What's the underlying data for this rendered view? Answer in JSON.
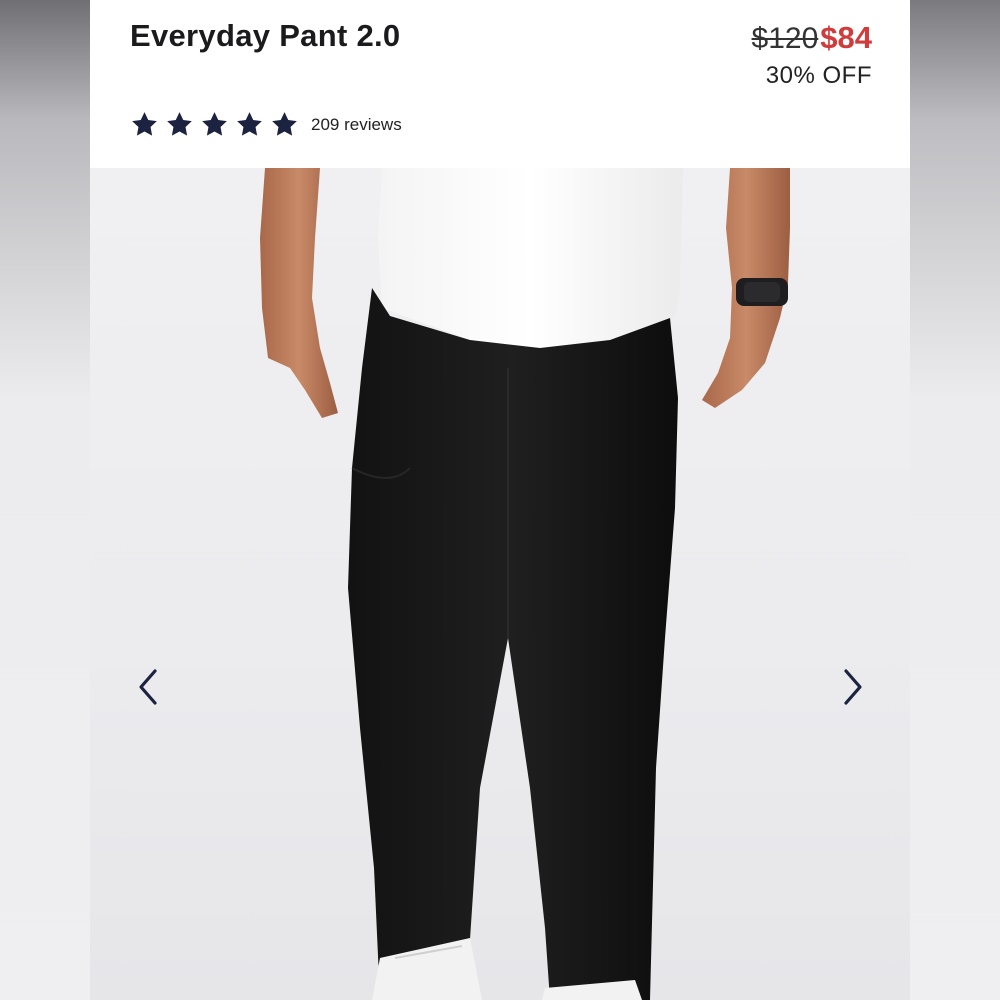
{
  "product": {
    "title": "Everyday Pant 2.0",
    "price_original": "$120",
    "price_sale": "$84",
    "discount": "30% OFF",
    "rating": 5,
    "review_count": "209 reviews"
  },
  "gallery": {
    "image_description": "product-photo-model-wearing-black-pants",
    "prev_icon": "chevron-left-icon",
    "next_icon": "chevron-right-icon"
  },
  "colors": {
    "star": "#1c2340",
    "sale_price": "#d13b3b",
    "arrow": "#1c2340"
  }
}
